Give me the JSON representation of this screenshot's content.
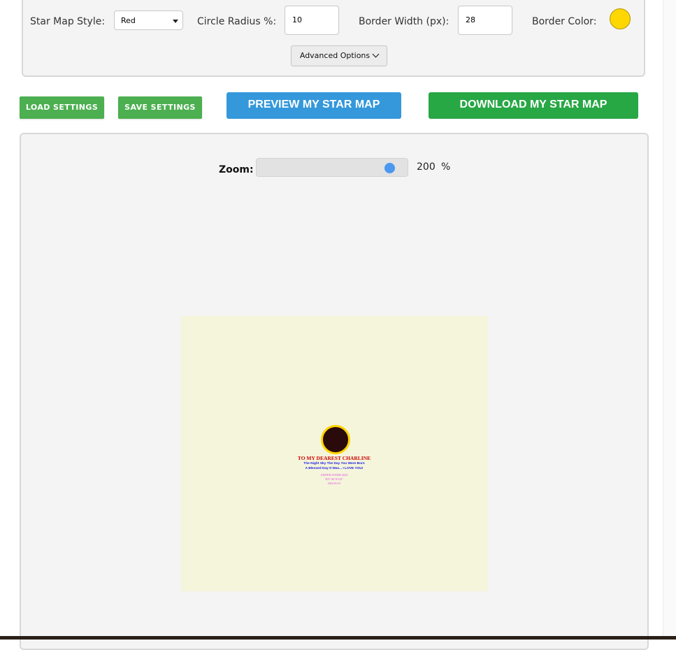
{
  "settings": {
    "star_map_style_label": "Star Map Style:",
    "star_map_style_value": "Red",
    "circle_radius_label": "Circle Radius %:",
    "circle_radius_value": "10",
    "border_width_label": "Border Width (px):",
    "border_width_value": "28",
    "border_color_label": "Border Color:",
    "border_color_value": "#FFD700",
    "advanced_options_label": "Advanced Options"
  },
  "actions": {
    "load_label": "LOAD SETTINGS",
    "save_label": "SAVE SETTINGS",
    "preview_label": "PREVIEW MY STAR MAP",
    "download_label": "DOWNLOAD MY STAR MAP",
    "colors": {
      "settings_buttons": "#4CAF50",
      "preview": "#3498DB",
      "download": "#28A745"
    }
  },
  "preview": {
    "zoom_label": "Zoom:",
    "zoom_value": "200",
    "zoom_unit": "%",
    "zoom_fraction": 0.92,
    "canvas_color": "#F5F5DC",
    "map": {
      "circle_color": "#2A0A0A",
      "circle_border": "#FFD400",
      "title": "TO MY DEAREST CHARLINE",
      "title_color": "#CC0000",
      "line1": "The Night Sky The Day You Were Born",
      "line2": "A Blessed Day It Was... I LOVE YOU!",
      "line3": "UNITED STATES 2023",
      "line4": "N37°46' W122°",
      "line5": "2024-01-01",
      "text_color_blue": "#1A1AE6",
      "text_color_pink": "#E040E0"
    }
  }
}
